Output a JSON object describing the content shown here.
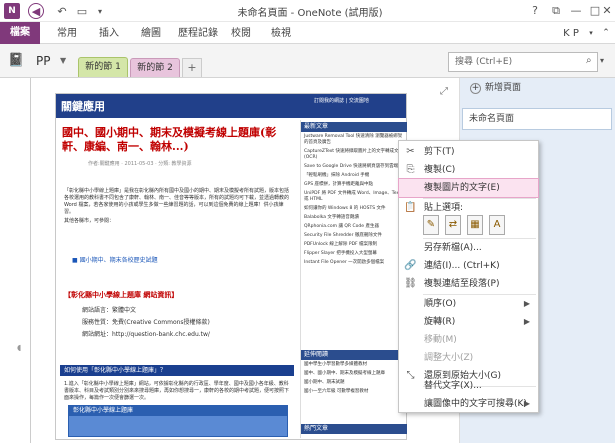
{
  "window": {
    "title": "未命名頁面 - OneNote (試用版)",
    "user": "K P",
    "controls": [
      "?",
      "—",
      "□",
      "✕"
    ]
  },
  "ribbon": {
    "tabs": [
      "檔案",
      "常用",
      "插入",
      "繪圖",
      "歷程記錄",
      "校閱",
      "檢視"
    ]
  },
  "notebook": {
    "name": "PP",
    "sections": [
      "新的節 1",
      "新的節 2"
    ],
    "add_section": "+"
  },
  "search": {
    "placeholder": "搜尋 (Ctrl+E)"
  },
  "pages": {
    "add_label": "新增頁面",
    "items": [
      "未命名頁面"
    ]
  },
  "web": {
    "site_title": "關鍵應用",
    "nav": "訂閱我的網誌 | 交流園地",
    "article_title": "國中、國小期中、期末及模擬考線上題庫(彰軒、康編、南一、翰林...)",
    "meta": "作者:關鍵應用 · 2011-05-03 · 分類: 教學資源",
    "para1": "「彰化縣中小學線上題庫」是我在彰化縣內所有國中及國小的期中、期末及模擬考所有試題，版本包括各校選用的教科書不同包含了康軒、翰林、南一、佳音等等版本，所有的試題均可下載，並透過轉教的 Word 檔案，若各家使用的小孩或學生多做一些練習題的話，可以到這個免費的線上題庫！供小孩練習。",
    "para1b": "其他各縣市，可參閱：",
    "bullet": "國小期中、期末各校歷史試題",
    "section_head": "【彰化縣中小學線上題庫 網站資訊】",
    "info_lang": "網站語言：繁體中文",
    "info_fee": "服務性質：免費(Creative Commons授權條款)",
    "info_url": "網站網址：http://question-bank.chc.edu.tw/",
    "how_to": "如何使用「彰化縣中小學線上題庫」？",
    "para2": "1.進入「彰化縣中小學線上題庫」網站，可依據彰化縣內的行政區、學年度、國中及國小各年級、教科書版本、科目及考試類別分別來來搜尋題庫，再如你想搜尋一，康軒的各校的期中考試題，便可按照下面來操作，每篇作一次便會篩選一次。",
    "screenshot_title": "彰化縣中小學線上題庫",
    "side_head1": "最新文章",
    "side_items": [
      "Justware Removal Tool 快速清除 瀏覽器被綁架的首頁及廣告",
      "CaptureZText 快速將擷取圖片上的文字轉成文字(OCR)",
      "Save to Google Drive 快速將網頁儲存到雲端",
      "「輕鬆刷機」抹除 Android 手機",
      "GPS 座標拼，計算手機距離與中點",
      "UniPDF 將 PDF 文件轉成 Word、Image、Text 或 HTML",
      "如何讓你的 Windows 8 的 HOSTS 文件",
      "Balabolka 文字轉語音朗讀",
      "QRphonia.com 讓 QR Code 產生器",
      "Security File Shredder 徹底刪除文件",
      "PDFUnlock 線上解除 PDF 檔案限制",
      "Flipper Slayer 把手機投入大型螢幕",
      "Instant File Opener 一次開啟多個檔案"
    ],
    "side_head2": "延伸閱讀",
    "side_items2": [
      "國中學生小學習數學多媒體教材",
      "國中、國小期中、期末及模擬考線上題庫",
      "國小期中、期末試題",
      "國小一至六年級 可數學複習教材"
    ],
    "side_head3": "熱門文章"
  },
  "context_menu": {
    "items": [
      {
        "label": "剪下(T)",
        "icon": "cut",
        "disabled": false
      },
      {
        "label": "複製(C)",
        "icon": "copy",
        "disabled": false
      },
      {
        "label": "複製圖片的文字(E)",
        "icon": "",
        "disabled": false,
        "highlighted": true
      },
      {
        "label": "貼上選項:",
        "icon": "paste",
        "disabled": false
      },
      {
        "label": "另存新檔(A)...",
        "icon": "",
        "disabled": false
      },
      {
        "label": "連結(I)...  (Ctrl+K)",
        "icon": "link",
        "disabled": false
      },
      {
        "label": "複製連結至段落(P)",
        "icon": "copy-link",
        "disabled": false
      },
      {
        "label": "順序(O)",
        "icon": "",
        "disabled": false,
        "submenu": true
      },
      {
        "label": "旋轉(R)",
        "icon": "",
        "disabled": false,
        "submenu": true
      },
      {
        "label": "移動(M)",
        "icon": "",
        "disabled": true
      },
      {
        "label": "調整大小(Z)",
        "icon": "",
        "disabled": true
      },
      {
        "label": "還原到原始大小(G)",
        "icon": "restore",
        "disabled": false
      },
      {
        "label": "替代文字(X)...",
        "icon": "",
        "disabled": false
      },
      {
        "label": "讓圖像中的文字可搜尋(K)",
        "icon": "",
        "disabled": false,
        "submenu": true
      }
    ]
  }
}
